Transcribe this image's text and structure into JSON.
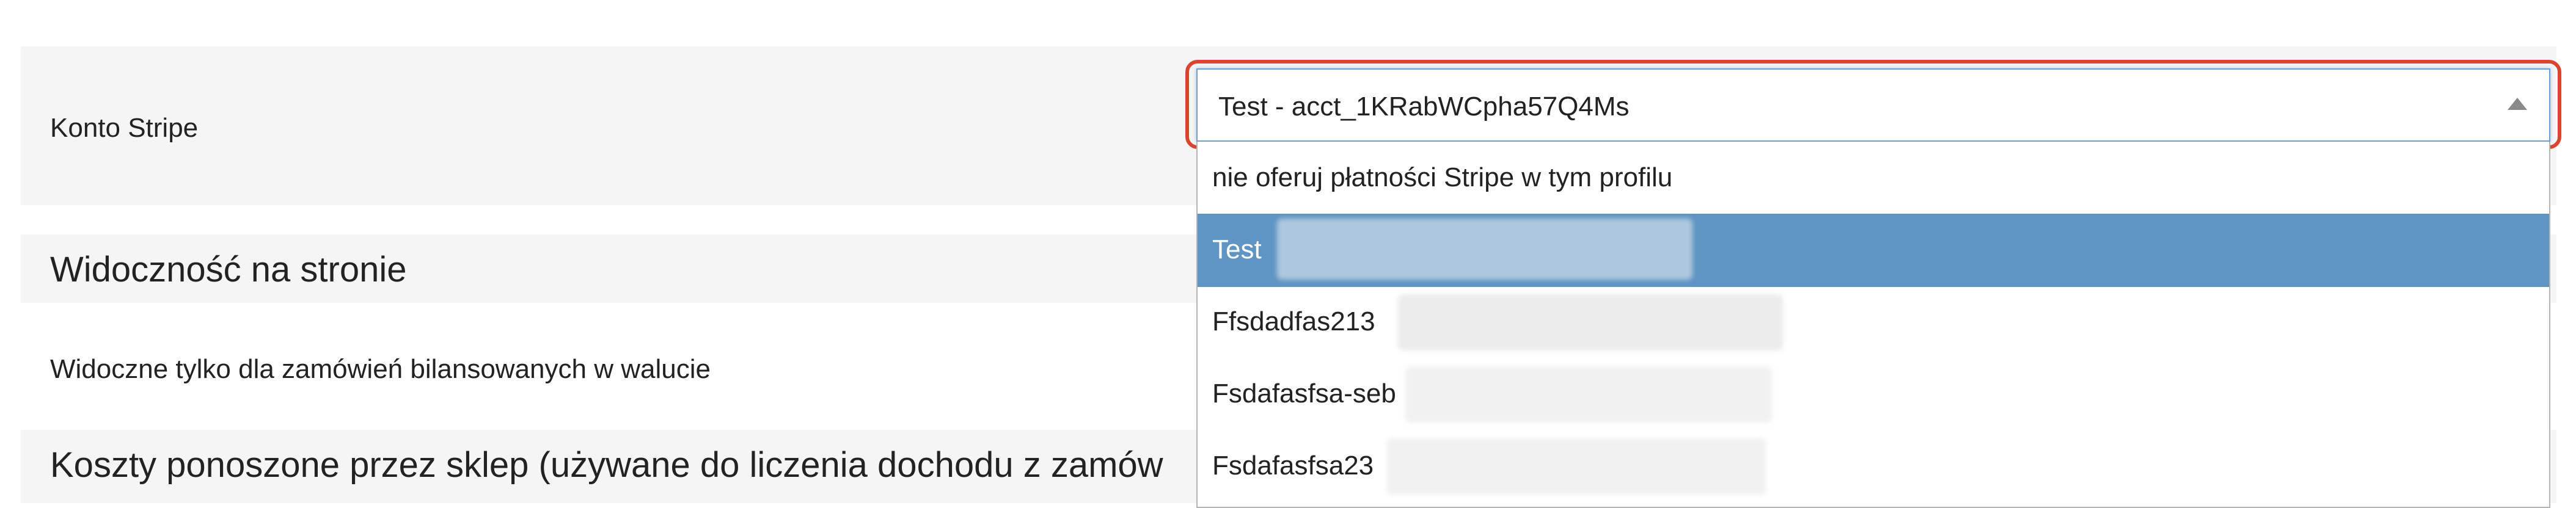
{
  "stripe_account": {
    "label": "Konto Stripe",
    "selected_value": "Test - acct_1KRabWCpha57Q4Ms",
    "options": [
      {
        "label": "nie oferuj płatności Stripe w tym profilu",
        "selected": false
      },
      {
        "label": "Test",
        "selected": true
      },
      {
        "label": "Ffsdadfas213",
        "selected": false
      },
      {
        "label": "Fsdafasfsa-seb",
        "selected": false
      },
      {
        "label": "Fsdafasfsa23",
        "selected": false
      }
    ],
    "highlight_color": "#d9452f",
    "selected_color": "#5f95c2"
  },
  "visibility_section": {
    "title": "Widoczność na stronie",
    "only_balanced_label": "Widoczne tylko dla zamówień bilansowanych w walucie"
  },
  "costs_section": {
    "title": "Koszty ponoszone przez sklep (używane do liczenia dochodu z zamów"
  }
}
